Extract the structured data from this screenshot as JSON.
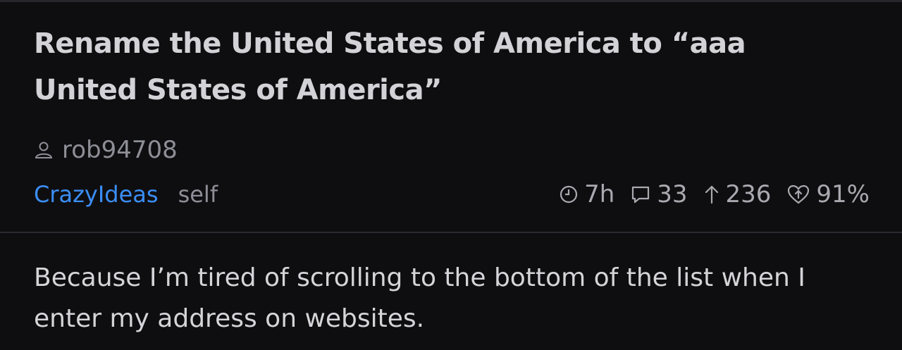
{
  "post": {
    "title": "Rename the United States of America to “aaa United States of America”",
    "author": "rob94708",
    "subreddit": "CrazyIdeas",
    "domain": "self",
    "age": "7h",
    "comments": "33",
    "score": "236",
    "upvote_ratio": "91%",
    "body": "Because I’m tired of scrolling to the bottom of the list when I enter my address on websites."
  },
  "icons": {
    "author": "person-icon",
    "age": "clock-icon",
    "comments": "comment-bubble-icon",
    "score": "up-arrow-icon",
    "upvote_ratio": "heart-upvote-icon"
  },
  "colors": {
    "background": "#0e0e11",
    "subreddit_link": "#3b8ef5",
    "title": "#d2d2d7",
    "muted": "#8e8e96",
    "divider": "#2a2a31"
  }
}
